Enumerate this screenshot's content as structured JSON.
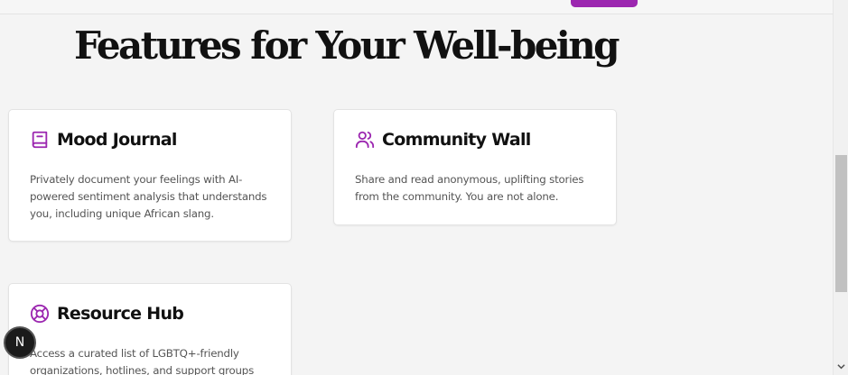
{
  "heading": "Features for Your Well-being",
  "colors": {
    "accent": "#9c27b0",
    "background": "#f4f4f4",
    "card": "#ffffff"
  },
  "cards": [
    {
      "title": "Mood Journal",
      "icon": "book-icon",
      "description": "Privately document your feelings with AI-powered sentiment analysis that understands you, including unique African slang."
    },
    {
      "title": "Community Wall",
      "icon": "users-icon",
      "description": "Share and read anonymous, uplifting stories from the community. You are not alone."
    },
    {
      "title": "Resource Hub",
      "icon": "lifebuoy-icon",
      "description": "Access a curated list of LGBTQ+-friendly organizations, hotlines, and support groups"
    }
  ],
  "dev_badge": {
    "label": "N"
  }
}
